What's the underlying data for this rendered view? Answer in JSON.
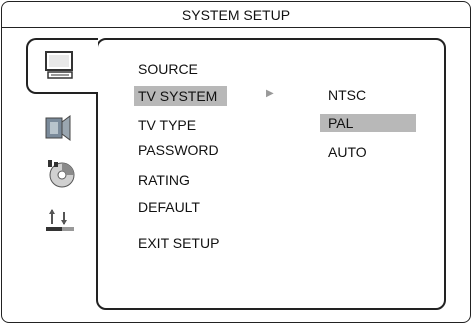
{
  "title": "SYSTEM SETUP",
  "menu": {
    "items": [
      {
        "label": "SOURCE"
      },
      {
        "label": "TV SYSTEM"
      },
      {
        "label": "TV TYPE"
      },
      {
        "label": "PASSWORD"
      },
      {
        "label": "RATING"
      },
      {
        "label": "DEFAULT"
      },
      {
        "label": "EXIT SETUP"
      }
    ],
    "selected_index": 1
  },
  "submenu": {
    "items": [
      {
        "label": "NTSC"
      },
      {
        "label": "PAL"
      },
      {
        "label": "AUTO"
      }
    ],
    "selected_index": 1
  },
  "arrow_glyph": "▶",
  "icons": [
    "monitor-icon",
    "audio-icon",
    "disc-icon",
    "preferences-icon"
  ]
}
